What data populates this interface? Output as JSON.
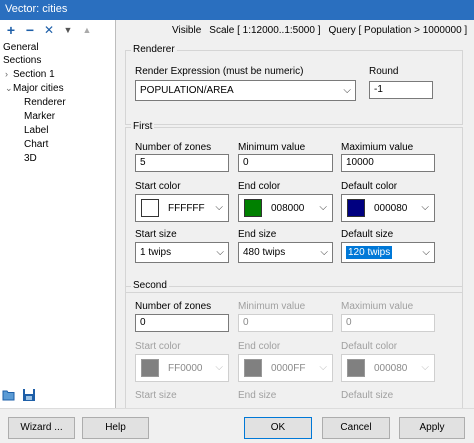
{
  "window": {
    "title": "Vector: cities"
  },
  "toolbar": {
    "add": "+",
    "remove": "−",
    "delete": "✕",
    "down": "▼",
    "up": "▲"
  },
  "tree": {
    "general": "General",
    "sections": "Sections",
    "section1": "Section  1",
    "major_cities": "Major cities",
    "renderer": "Renderer",
    "marker": "Marker",
    "label": "Label",
    "chart": "Chart",
    "d3": "3D"
  },
  "header": {
    "visible": "Visible",
    "scale": "Scale [ 1:12000..1:5000 ]",
    "query": "Query [ Population > 1000000 ]"
  },
  "renderer": {
    "group_label": "Renderer",
    "expression_label": "Render Expression (must be numeric)",
    "expression_value": "POPULATION/AREA",
    "round_label": "Round",
    "round_value": "-1"
  },
  "first": {
    "group_label": "First",
    "zones_label": "Number of zones",
    "zones_value": "5",
    "min_label": "Minimum value",
    "min_value": "0",
    "max_label": "Maximium value",
    "max_value": "10000",
    "start_color_label": "Start color",
    "start_color": "FFFFFF",
    "start_color_hex": "#FFFFFF",
    "end_color_label": "End color",
    "end_color": "008000",
    "end_color_hex": "#008000",
    "default_color_label": "Default color",
    "default_color": "000080",
    "default_color_hex": "#000080",
    "start_size_label": "Start size",
    "start_size": "1 twips",
    "end_size_label": "End size",
    "end_size": "480 twips",
    "default_size_label": "Default size",
    "default_size": "120 twips"
  },
  "second": {
    "group_label": "Second",
    "zones_label": "Number of zones",
    "zones_value": "0",
    "min_label": "Minimum value",
    "min_value": "0",
    "max_label": "Maximium value",
    "max_value": "0",
    "start_color_label": "Start color",
    "start_color": "FF0000",
    "end_color_label": "End color",
    "end_color": "0000FF",
    "default_color_label": "Default color",
    "default_color": "000080",
    "disabled_swatch_hex": "#808080",
    "start_size_label": "Start size",
    "end_size_label": "End size",
    "default_size_label": "Default size"
  },
  "buttons": {
    "wizard": "Wizard ...",
    "help": "Help",
    "ok": "OK",
    "cancel": "Cancel",
    "apply": "Apply"
  }
}
